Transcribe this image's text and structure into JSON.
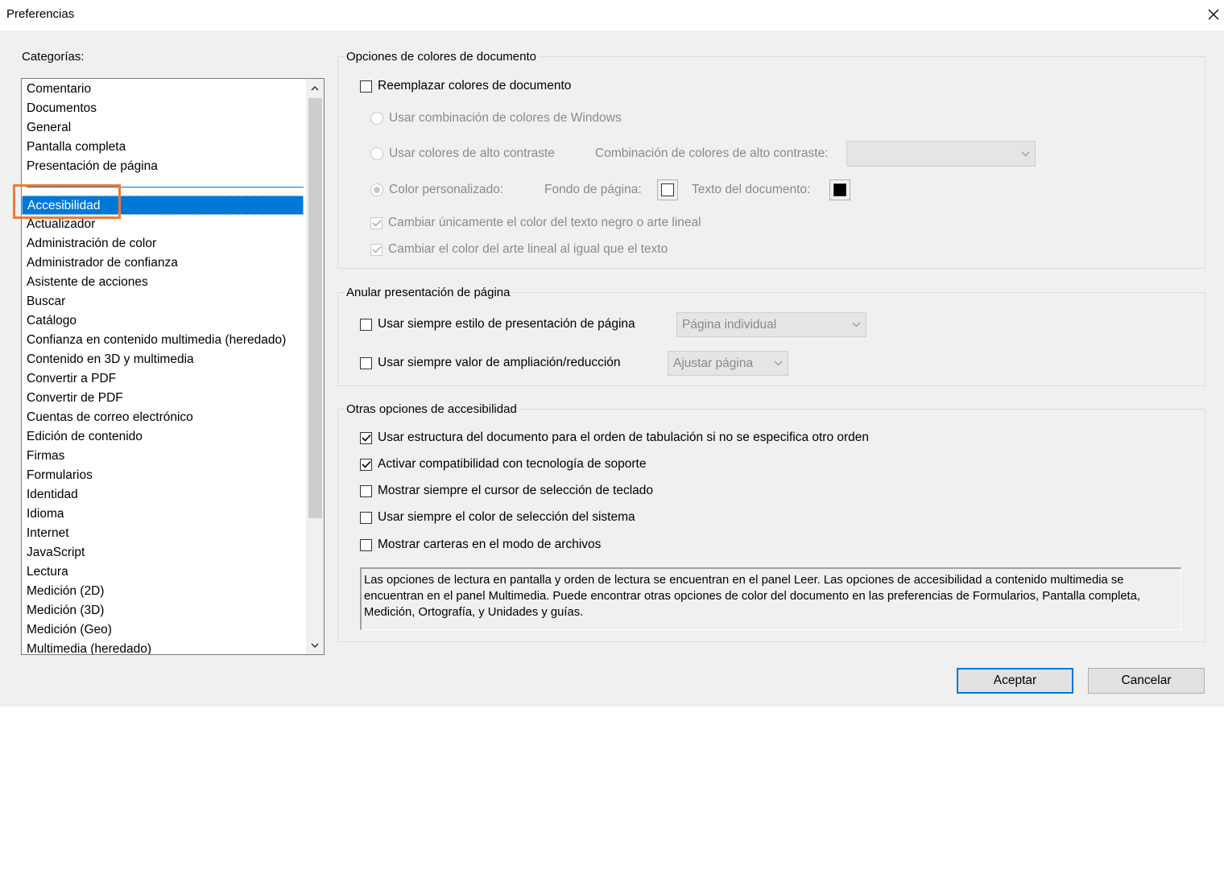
{
  "window": {
    "title": "Preferencias"
  },
  "categories": {
    "label": "Categorías:",
    "items": [
      "Comentario",
      "Documentos",
      "General",
      "Pantalla completa",
      "Presentación de página",
      "Accesibilidad",
      "Actualizador",
      "Administración de color",
      "Administrador de confianza",
      "Asistente de acciones",
      "Buscar",
      "Catálogo",
      "Confianza en contenido multimedia (heredado)",
      "Contenido en 3D y multimedia",
      "Convertir a PDF",
      "Convertir de PDF",
      "Cuentas de correo electrónico",
      "Edición de contenido",
      "Firmas",
      "Formularios",
      "Identidad",
      "Idioma",
      "Internet",
      "JavaScript",
      "Lectura",
      "Medición (2D)",
      "Medición (3D)",
      "Medición (Geo)",
      "Multimedia (heredado)"
    ],
    "selected": "Accesibilidad"
  },
  "doc_colors": {
    "title": "Opciones de colores de documento",
    "replace_label": "Reemplazar colores de documento",
    "windows_scheme_label": "Usar combinación de colores de Windows",
    "high_contrast_label": "Usar colores de alto contraste",
    "high_contrast_scheme_label": "Combinación de colores de alto contraste:",
    "high_contrast_scheme_value": "",
    "custom_color_label": "Color personalizado:",
    "page_bg_label": "Fondo de página:",
    "page_bg_color": "#ffffff",
    "doc_text_label": "Texto del documento:",
    "doc_text_color": "#000000",
    "only_black_text_label": "Cambiar únicamente el color del texto negro o arte lineal",
    "line_art_label": "Cambiar el color del arte lineal al igual que el texto"
  },
  "page_display": {
    "title": "Anular presentación de página",
    "layout_label": "Usar siempre estilo de presentación de página",
    "layout_value": "Página individual",
    "zoom_label": "Usar siempre valor de ampliación/reducción",
    "zoom_value": "Ajustar página"
  },
  "other": {
    "title": "Otras opciones de accesibilidad",
    "options": [
      {
        "label": "Usar estructura del documento para el orden de tabulación si no se especifica otro orden",
        "checked": true
      },
      {
        "label": "Activar compatibilidad con tecnología de soporte",
        "checked": true
      },
      {
        "label": "Mostrar siempre el cursor de selección de teclado",
        "checked": false
      },
      {
        "label": "Usar siempre el color de selección del sistema",
        "checked": false
      },
      {
        "label": "Mostrar carteras en el modo de archivos",
        "checked": false
      }
    ],
    "info": "Las opciones de lectura en pantalla y orden de lectura se encuentran en el panel Leer. Las opciones de accesibilidad a contenido multimedia se encuentran en el panel Multimedia. Puede encontrar otras opciones de color del documento en las preferencias de Formularios, Pantalla completa, Medición, Ortografía, y Unidades y guías."
  },
  "buttons": {
    "ok": "Aceptar",
    "cancel": "Cancelar"
  },
  "colors": {
    "accent": "#0078d7",
    "highlight_box": "#ef7a33"
  }
}
